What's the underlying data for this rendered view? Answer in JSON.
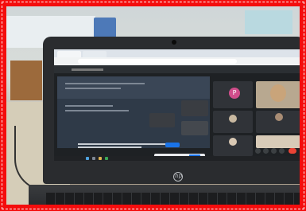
{
  "scene": {
    "description_tag": "photo",
    "frame_border_color": "#f40d0d",
    "laptop_brand_logo": "hp"
  },
  "meeting_app": {
    "participant_avatar_letter": "P",
    "accent_color": "#1a73e8",
    "avatar_color": "#d04e8b"
  }
}
